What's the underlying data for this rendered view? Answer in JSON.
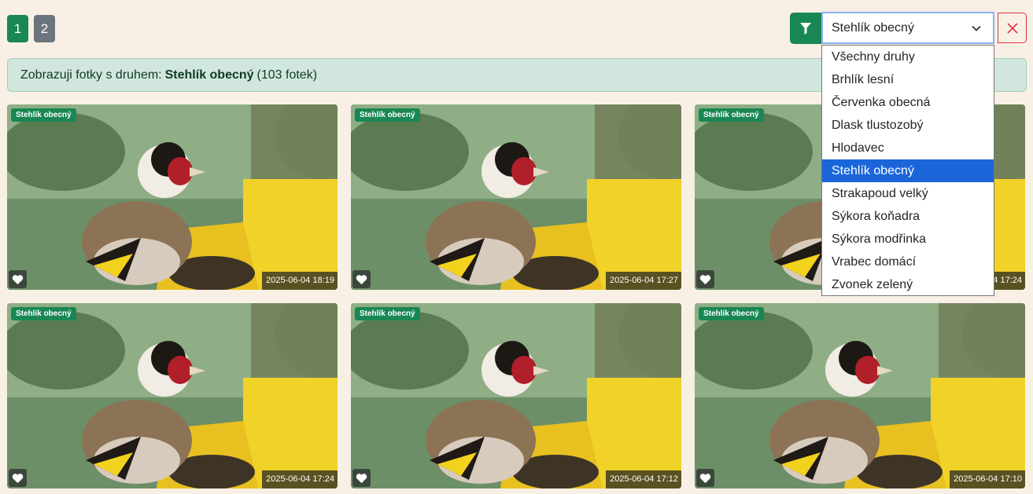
{
  "pagination": {
    "pages": [
      "1",
      "2"
    ]
  },
  "filter": {
    "selected": "Stehlík obecný",
    "options": [
      "Všechny druhy",
      "Brhlík lesní",
      "Červenka obecná",
      "Dlask tlustozobý",
      "Hlodavec",
      "Stehlík obecný",
      "Strakapoud velký",
      "Sýkora koňadra",
      "Sýkora modřinka",
      "Vrabec domácí",
      "Zvonek zelený"
    ]
  },
  "info": {
    "prefix": "Zobrazuji fotky s druhem:",
    "species": "Stehlík obecný",
    "count": "(103 fotek)"
  },
  "photos": [
    {
      "species": "Stehlík obecný",
      "timestamp": "2025-06-04 18:19"
    },
    {
      "species": "Stehlík obecný",
      "timestamp": "2025-06-04 17:27"
    },
    {
      "species": "Stehlík obecný",
      "timestamp": "2025-06-04 17:24"
    },
    {
      "species": "Stehlík obecný",
      "timestamp": "2025-06-04 17:24"
    },
    {
      "species": "Stehlík obecný",
      "timestamp": "2025-06-04 17:12"
    },
    {
      "species": "Stehlík obecný",
      "timestamp": "2025-06-04 17:10"
    }
  ],
  "colors": {
    "accent": "#198754",
    "page_bg": "#f8f0e4",
    "highlight": "#1a66d9"
  }
}
